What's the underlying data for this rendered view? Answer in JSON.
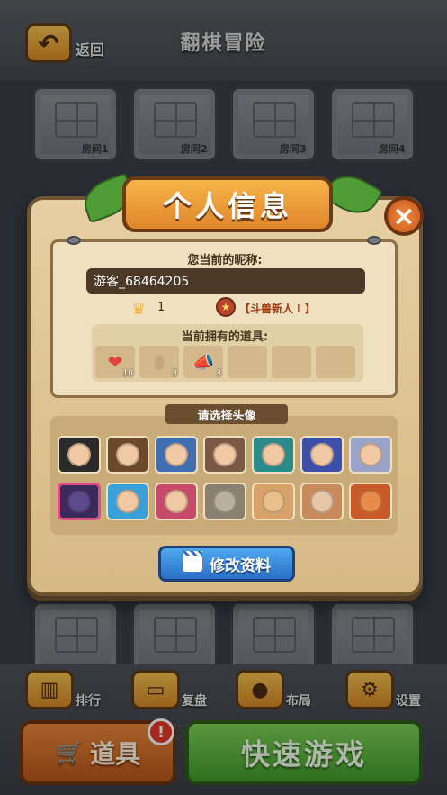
{
  "header": {
    "back_label": "返回",
    "title": "翻棋冒险"
  },
  "rooms_top": [
    {
      "label": "房间1"
    },
    {
      "label": "房间2"
    },
    {
      "label": "房间3"
    },
    {
      "label": "房间4"
    }
  ],
  "bottom_menu": [
    {
      "label": "排行",
      "icon": "bar-chart-icon"
    },
    {
      "label": "复盘",
      "icon": "tv-icon"
    },
    {
      "label": "布局",
      "icon": "drops-icon"
    },
    {
      "label": "设置",
      "icon": "gear-icon"
    }
  ],
  "buttons": {
    "props": "道具",
    "quick_game": "快速游戏",
    "alert": "!"
  },
  "dialog": {
    "title": "个人信息",
    "nickname_label": "您当前的昵称:",
    "nickname_value": "游客_68464205",
    "level": "1",
    "rank_title": "【斗兽新人 I 】",
    "items_label": "当前拥有的道具:",
    "items": [
      {
        "name": "heart",
        "count": "10"
      },
      {
        "name": "egg",
        "count": "3"
      },
      {
        "name": "horn",
        "count": "3"
      }
    ],
    "avatar_label": "请选择头像",
    "edit_button": "修改资料"
  },
  "colors": {
    "panel": "#e6cfa3",
    "accent_orange": "#e0852a",
    "green": "#3f9a2b",
    "blue": "#2a6fc7"
  }
}
